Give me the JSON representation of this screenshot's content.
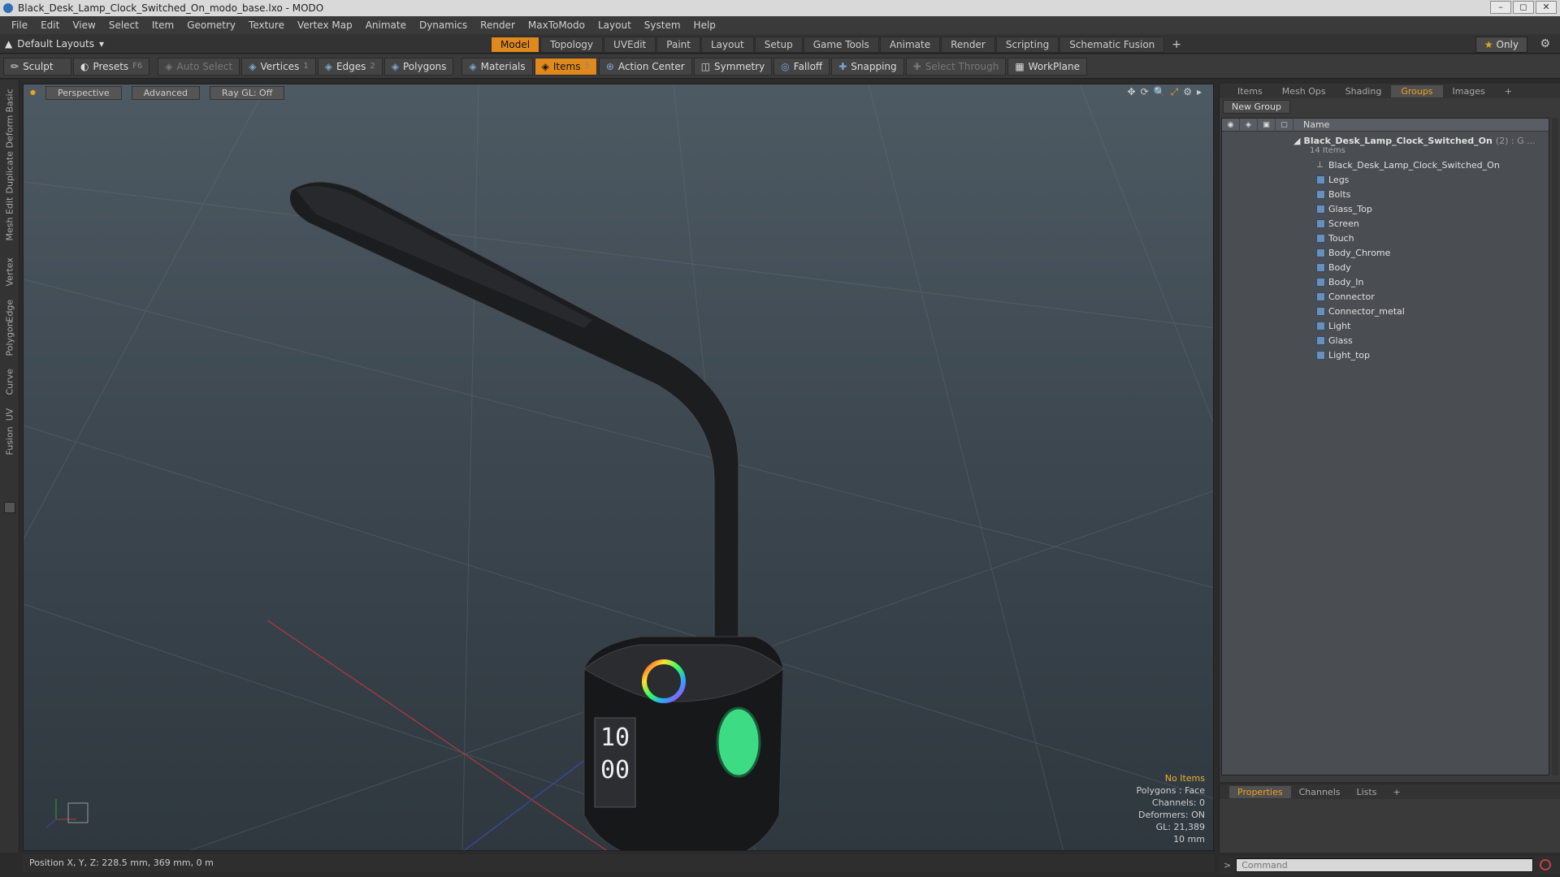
{
  "window": {
    "title": "Black_Desk_Lamp_Clock_Switched_On_modo_base.lxo - MODO"
  },
  "menu": [
    "File",
    "Edit",
    "View",
    "Select",
    "Item",
    "Geometry",
    "Texture",
    "Vertex Map",
    "Animate",
    "Dynamics",
    "Render",
    "MaxToModo",
    "Layout",
    "System",
    "Help"
  ],
  "layout": {
    "selector": "Default Layouts",
    "tabs": [
      "Model",
      "Topology",
      "UVEdit",
      "Paint",
      "Layout",
      "Setup",
      "Game Tools",
      "Animate",
      "Render",
      "Scripting",
      "Schematic Fusion"
    ],
    "active_tab": "Model",
    "add": "+",
    "only": "Only"
  },
  "toolbar": {
    "sculpt": "Sculpt",
    "presets": "Presets",
    "presets_key": "F6",
    "auto_select": "Auto Select",
    "vertices": "Vertices",
    "vertices_key": "1",
    "edges": "Edges",
    "edges_key": "2",
    "polygons": "Polygons",
    "materials": "Materials",
    "items": "Items",
    "items_key": "5",
    "action_center": "Action Center",
    "symmetry": "Symmetry",
    "falloff": "Falloff",
    "snapping": "Snapping",
    "select_through": "Select Through",
    "workplane": "WorkPlane"
  },
  "left_tabs": [
    "Basic",
    "Deform",
    "Duplicate",
    "Mesh Edit",
    "Vertex",
    "Edge",
    "Polygon",
    "Curve",
    "UV",
    "Fusion"
  ],
  "viewport": {
    "perspective": "Perspective",
    "advanced": "Advanced",
    "raygl": "Ray GL: Off",
    "clock_hour": "10",
    "clock_min": "00",
    "info": {
      "no_items": "No Items",
      "polygons": "Polygons : Face",
      "channels": "Channels: 0",
      "deformers": "Deformers: ON",
      "gl": "GL: 21,389",
      "scale": "10 mm"
    }
  },
  "status": {
    "position": "Position X, Y, Z:  228.5 mm, 369 mm, 0 m"
  },
  "groups_panel": {
    "tabs": [
      "Items",
      "Mesh Ops",
      "Shading",
      "Groups",
      "Images",
      "+"
    ],
    "active_tab": "Groups",
    "new_group": "New Group",
    "col_name": "Name",
    "root": "Black_Desk_Lamp_Clock_Switched_On",
    "root_suffix": "(2) : G ...",
    "root_count": "14 Items",
    "items": [
      "Black_Desk_Lamp_Clock_Switched_On",
      "Legs",
      "Bolts",
      "Glass_Top",
      "Screen",
      "Touch",
      "Body_Chrome",
      "Body",
      "Body_In",
      "Connector",
      "Connector_metal",
      "Light",
      "Glass",
      "Light_top"
    ]
  },
  "props_panel": {
    "tabs": [
      "Properties",
      "Channels",
      "Lists",
      "+"
    ],
    "active_tab": "Properties"
  },
  "command": {
    "placeholder": "Command"
  },
  "colors": {
    "accent": "#e08a1e",
    "highlight_text": "#f0b030",
    "green_light": "#3ddc84"
  }
}
